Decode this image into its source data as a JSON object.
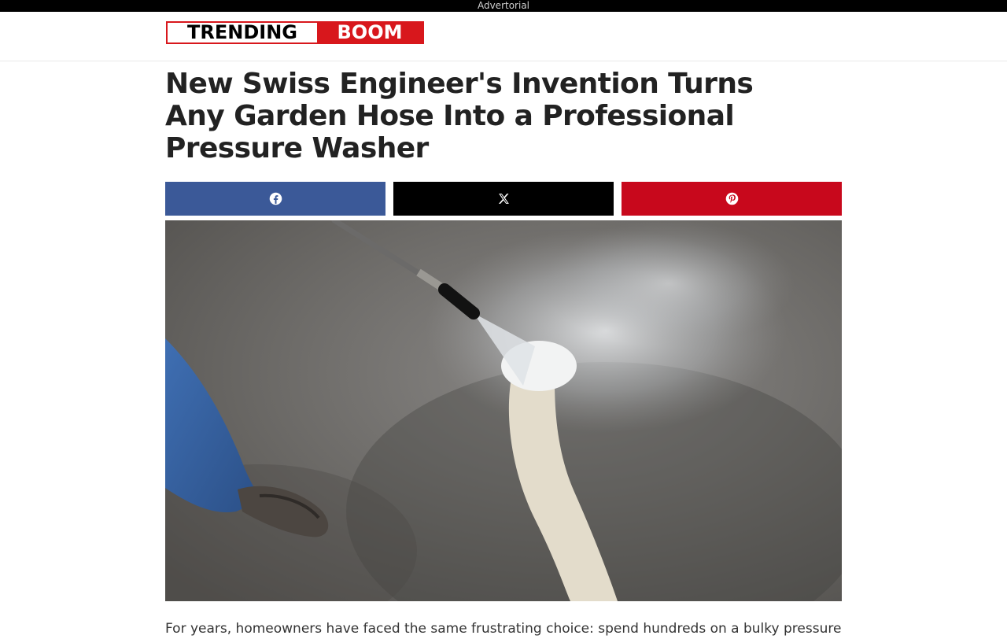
{
  "adbar": {
    "label": "Advertorial"
  },
  "logo": {
    "left": "TRENDING",
    "right": "BOOM"
  },
  "article": {
    "headline": "New Swiss Engineer's Invention Turns Any Garden Hose Into a Professional Pressure Washer",
    "intro": "For years, homeowners have faced the same frustrating choice: spend hundreds on a bulky pressure"
  },
  "share": {
    "buttons": [
      {
        "network": "facebook",
        "icon": "facebook-icon",
        "color": "#3b5998"
      },
      {
        "network": "x",
        "icon": "x-icon",
        "color": "#000000"
      },
      {
        "network": "pinterest",
        "icon": "pinterest-icon",
        "color": "#c8081c"
      }
    ]
  },
  "colors": {
    "brand_red": "#d8171c",
    "text": "#222222"
  }
}
